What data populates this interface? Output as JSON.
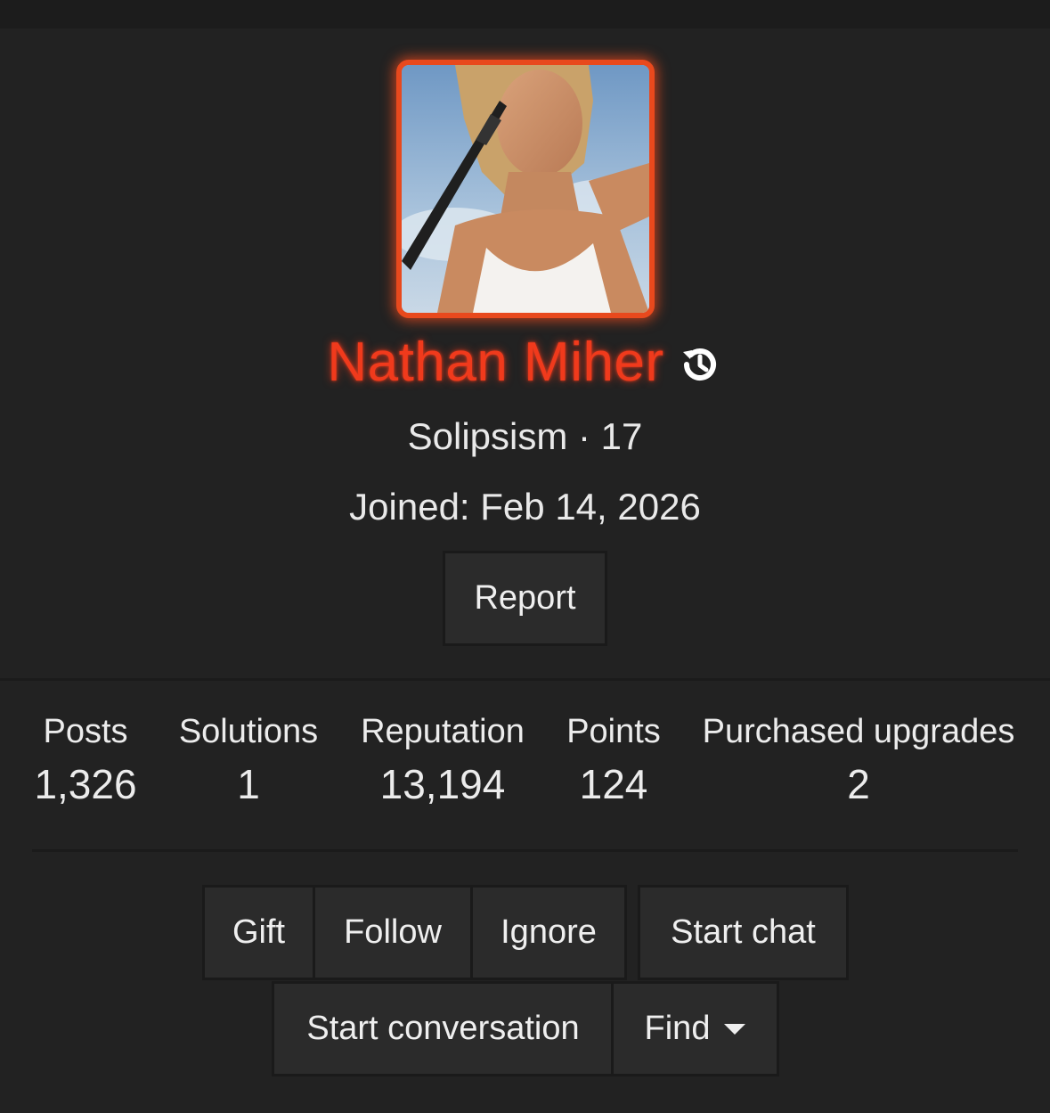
{
  "profile": {
    "username": "Nathan Miher",
    "user_title": "Solipsism",
    "separator": "·",
    "level": "17",
    "joined_label": "Joined:",
    "joined_date": "Feb 14, 2026",
    "name_color": "#f03a1c",
    "avatar_border_color": "#e8491d"
  },
  "actions": {
    "report": "Report",
    "gift": "Gift",
    "follow": "Follow",
    "ignore": "Ignore",
    "start_chat": "Start chat",
    "start_conversation": "Start conversation",
    "find": "Find"
  },
  "stats": [
    {
      "label": "Posts",
      "value": "1,326"
    },
    {
      "label": "Solutions",
      "value": "1"
    },
    {
      "label": "Reputation",
      "value": "13,194"
    },
    {
      "label": "Points",
      "value": "124"
    },
    {
      "label": "Purchased upgrades",
      "value": "2"
    }
  ],
  "icons": {
    "username_icon": "history-icon",
    "find_icon": "caret-down-icon"
  }
}
